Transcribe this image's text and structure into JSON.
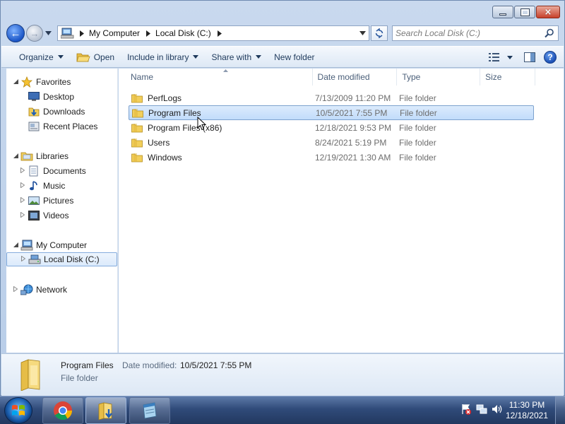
{
  "window": {
    "caption_close": "×"
  },
  "nav": {
    "back_arrow": "←",
    "forward_arrow": "→",
    "breadcrumbs": [
      "My Computer",
      "Local Disk (C:)"
    ],
    "search_placeholder": "Search Local Disk (C:)"
  },
  "toolbar": {
    "organize": "Organize",
    "open": "Open",
    "include_in_library": "Include in library",
    "share_with": "Share with",
    "new_folder": "New folder",
    "help": "?"
  },
  "sidebar": {
    "favorites": "Favorites",
    "desktop": "Desktop",
    "downloads": "Downloads",
    "recent_places": "Recent Places",
    "libraries": "Libraries",
    "documents": "Documents",
    "music": "Music",
    "pictures": "Pictures",
    "videos": "Videos",
    "my_computer": "My Computer",
    "local_disk": "Local Disk (C:)",
    "network": "Network"
  },
  "columns": {
    "name": "Name",
    "date_modified": "Date modified",
    "type": "Type",
    "size": "Size"
  },
  "files": [
    {
      "name": "PerfLogs",
      "date": "7/13/2009 11:20 PM",
      "type": "File folder",
      "selected": false
    },
    {
      "name": "Program Files",
      "date": "10/5/2021 7:55 PM",
      "type": "File folder",
      "selected": true
    },
    {
      "name": "Program Files (x86)",
      "date": "12/18/2021 9:53 PM",
      "type": "File folder",
      "selected": false
    },
    {
      "name": "Users",
      "date": "8/24/2021 5:19 PM",
      "type": "File folder",
      "selected": false
    },
    {
      "name": "Windows",
      "date": "12/19/2021 1:30 AM",
      "type": "File folder",
      "selected": false
    }
  ],
  "details": {
    "name": "Program Files",
    "date_label": "Date modified:",
    "date_value": "10/5/2021 7:55 PM",
    "type": "File folder"
  },
  "taskbar": {
    "time": "11:30 PM",
    "date": "12/18/2021"
  },
  "colors": {
    "selection_border": "#7da2ce",
    "folder_yellow": "#f2cf5b",
    "link_blue": "#1e395b"
  },
  "icons": {
    "back": "back-arrow-icon",
    "forward": "forward-arrow-icon",
    "refresh": "refresh-icon",
    "search": "search-icon",
    "folder": "folder-icon",
    "help": "help-icon"
  }
}
